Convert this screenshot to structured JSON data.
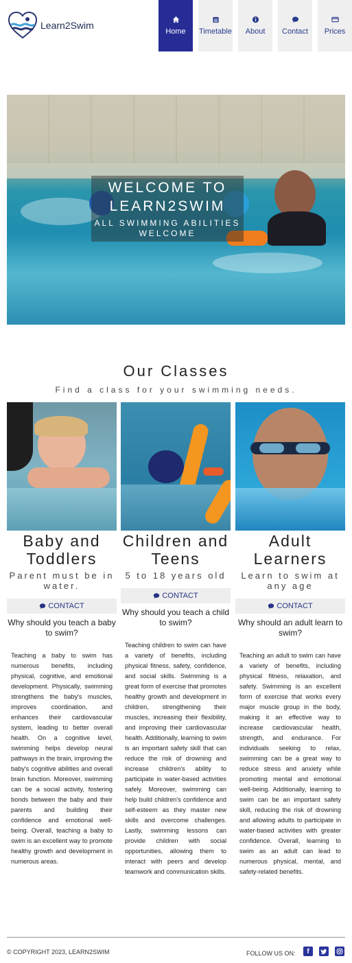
{
  "brand": {
    "name": "Learn2Swim",
    "logo_icon": "heart-wave-logo"
  },
  "nav": {
    "items": [
      {
        "label": "Home",
        "icon": "home-icon",
        "active": true
      },
      {
        "label": "Timetable",
        "icon": "calendar-icon",
        "active": false
      },
      {
        "label": "About",
        "icon": "info-icon",
        "active": false
      },
      {
        "label": "Contact",
        "icon": "chat-icon",
        "active": false
      },
      {
        "label": "Prices",
        "icon": "card-icon",
        "active": false
      }
    ],
    "active_color": "#262c94"
  },
  "hero": {
    "title": "WELCOME TO LEARN2SWIM",
    "subtitle": "ALL SWIMMING ABILITIES WELCOME"
  },
  "classes": {
    "title": "Our Classes",
    "subtitle": "Find a class for your swimming needs.",
    "cards": [
      {
        "name": "Baby and Toddlers",
        "tagline": "Parent must be in water.",
        "button": "CONTACT",
        "question": "Why should you teach a baby to swim?",
        "body": "Teaching a baby to swim has numerous benefits, including physical, cognitive, and emotional development. Physically, swimming strengthens the baby's muscles, improves coordination, and enhances their cardiovascular system, leading to better overall health. On a cognitive level, swimming helps develop neural pathways in the brain, improving the baby's cognitive abilities and overall brain function. Moreover, swimming can be a social activity, fostering bonds between the baby and their parents and building their confidence and emotional well-being. Overall, teaching a baby to swim is an excellent way to promote healthy growth and development in numerous areas."
      },
      {
        "name": "Children and Teens",
        "tagline": "5 to 18 years old",
        "button": "CONTACT",
        "question": "Why should you teach a child to swim?",
        "body": "Teaching children to swim can have a variety of benefits, including physical fitness, safety, confidence, and social skills. Swimming is a great form of exercise that promotes healthy growth and development in children, strengthening their muscles, increasing their flexibility, and improving their cardiovascular health. Additionally, learning to swim is an important safety skill that can reduce the risk of drowning and increase children's ability to participate in water-based activities safely. Moreover, swimming can help build children's confidence and self-esteem as they master new skills and overcome challenges. Lastly, swimming lessons can provide children with social opportunities, allowing them to interact with peers and develop teamwork and communication skills."
      },
      {
        "name": "Adult Learners",
        "tagline": "Learn to swim at any age",
        "button": "CONTACT",
        "question": "Why should an adult learn to swim?",
        "body": "Teaching an adult to swim can have a variety of benefits, including physical fitness, relaxation, and safety. Swimming is an excellent form of exercise that works every major muscle group in the body, making it an effective way to increase cardiovascular health, strength, and endurance. For individuals seeking to relax, swimming can be a great way to reduce stress and anxiety while promoting mental and emotional well-being. Additionally, learning to swim can be an important safety skill, reducing the risk of drowning and allowing adults to participate in water-based activities with greater confidence. Overall, learning to swim as an adult can lead to numerous physical, mental, and safety-related benefits."
      }
    ]
  },
  "footer": {
    "copyright": "© COPYRIGHT 2023, LEARN2SWIM",
    "follow_label": "FOLLOW US ON:",
    "social": [
      "facebook-icon",
      "twitter-icon",
      "instagram-icon"
    ]
  }
}
